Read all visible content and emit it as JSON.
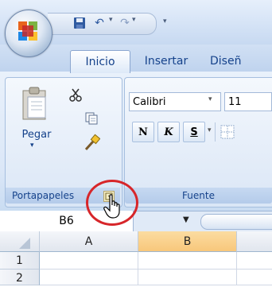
{
  "tabs": [
    {
      "label": "Inicio",
      "active": true
    },
    {
      "label": "Insertar",
      "active": false
    },
    {
      "label": "Diseñ",
      "active": false
    }
  ],
  "qat_separator": "▾",
  "clipboard": {
    "paste_label": "Pegar",
    "group_label": "Portapapeles"
  },
  "font": {
    "name": "Calibri",
    "size": "11",
    "bold_label": "N",
    "italic_label": "K",
    "underline_label": "S",
    "group_label": "Fuente"
  },
  "formula_bar": {
    "namebox_value": "B6"
  },
  "grid": {
    "columns": [
      "A",
      "B"
    ],
    "rows": [
      "1",
      "2"
    ]
  },
  "colors": {
    "accent": "#15428b",
    "selected_column": "#f8c77b",
    "highlight_ring": "#d7262a"
  }
}
